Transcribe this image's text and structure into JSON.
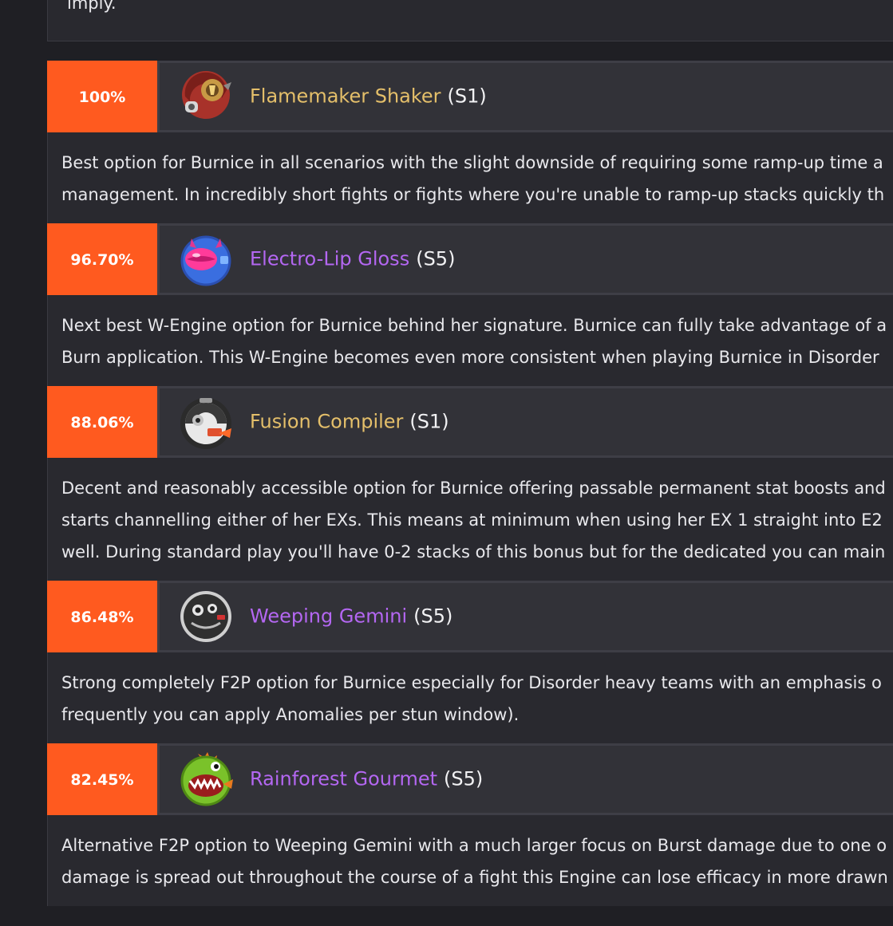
{
  "intro": {
    "tail_text": "imply."
  },
  "entries": [
    {
      "percent": "100%",
      "name": "Flamemaker Shaker",
      "refinement": "(S1)",
      "rarity_color": "gold",
      "icon": "flamemaker-shaker-icon",
      "description_lines": [
        "Best option for Burnice in all scenarios with the slight downside of requiring some ramp-up time a",
        "management. In incredibly short fights or fights where you're unable to ramp-up stacks quickly th"
      ]
    },
    {
      "percent": "96.70%",
      "name": "Electro-Lip Gloss",
      "refinement": "(S5)",
      "rarity_color": "purple",
      "icon": "electro-lip-gloss-icon",
      "description_lines": [
        "Next best W-Engine option for Burnice behind her signature. Burnice can fully take advantage of a",
        "Burn application. This W-Engine becomes even more consistent when playing Burnice in Disorder"
      ]
    },
    {
      "percent": "88.06%",
      "name": "Fusion Compiler",
      "refinement": "(S1)",
      "rarity_color": "gold",
      "icon": "fusion-compiler-icon",
      "description_lines": [
        "Decent and reasonably accessible option for Burnice offering passable permanent stat boosts and",
        "starts channelling either of her EXs. This means at minimum when using her EX 1 straight into E2",
        "well. During standard play you'll have 0-2 stacks of this bonus but for the dedicated you can main"
      ]
    },
    {
      "percent": "86.48%",
      "name": "Weeping Gemini",
      "refinement": "(S5)",
      "rarity_color": "purple",
      "icon": "weeping-gemini-icon",
      "description_lines": [
        "Strong completely F2P option for Burnice especially for Disorder heavy teams with an emphasis o",
        "frequently you can apply Anomalies per stun window)."
      ]
    },
    {
      "percent": "82.45%",
      "name": "Rainforest Gourmet",
      "refinement": "(S5)",
      "rarity_color": "purple",
      "icon": "rainforest-gourmet-icon",
      "description_lines": [
        "Alternative F2P option to Weeping Gemini with a much larger focus on Burst damage due to one o",
        "damage is spread out throughout the course of a fight this Engine can lose efficacy in more drawn"
      ]
    }
  ],
  "colors": {
    "percent_badge": "#ff5a1f",
    "gold_name": "#e4bf6a",
    "purple_name": "#b467f2",
    "panel": "#323238",
    "description_bg": "#29292f",
    "page_bg": "#1f1f24"
  }
}
